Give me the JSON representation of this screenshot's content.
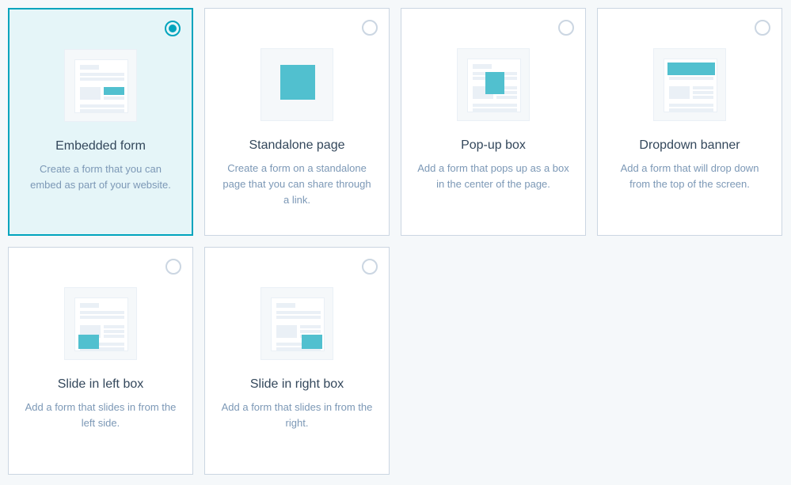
{
  "options": [
    {
      "id": "embedded-form",
      "title": "Embedded form",
      "desc": "Create a form that you can embed as part of your website.",
      "selected": true,
      "thumb": "embedded"
    },
    {
      "id": "standalone-page",
      "title": "Standalone page",
      "desc": "Create a form on a standalone page that you can share through a link.",
      "selected": false,
      "thumb": "standalone"
    },
    {
      "id": "popup-box",
      "title": "Pop-up box",
      "desc": "Add a form that pops up as a box in the center of the page.",
      "selected": false,
      "thumb": "popup"
    },
    {
      "id": "dropdown-banner",
      "title": "Dropdown banner",
      "desc": "Add a form that will drop down from the top of the screen.",
      "selected": false,
      "thumb": "dropdown"
    },
    {
      "id": "slide-left",
      "title": "Slide in left box",
      "desc": "Add a form that slides in from the left side.",
      "selected": false,
      "thumb": "slideleft"
    },
    {
      "id": "slide-right",
      "title": "Slide in right box",
      "desc": "Add a form that slides in from the right.",
      "selected": false,
      "thumb": "slideright"
    }
  ]
}
